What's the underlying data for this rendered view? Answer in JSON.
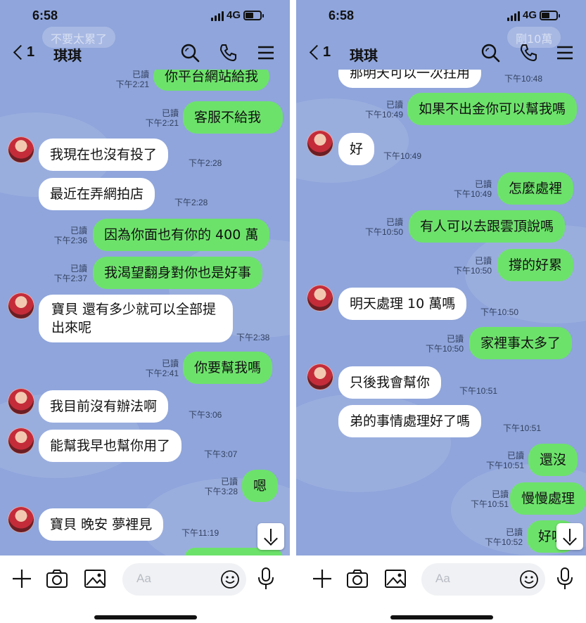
{
  "status": {
    "time": "6:58",
    "network": "4G"
  },
  "header": {
    "unread": "1",
    "contact": "琪琪"
  },
  "left": {
    "ghost_text": "不要太累了",
    "messages": [
      {
        "dir": "out",
        "text": "你平台網站給我",
        "read": "已讀",
        "time": "下午2:21"
      },
      {
        "dir": "out",
        "text": "客服不給我",
        "read": "已讀",
        "time": "下午2:21"
      },
      {
        "dir": "in",
        "text": "我現在也沒有投了",
        "time": "下午2:28",
        "avatar": true
      },
      {
        "dir": "in",
        "text": "最近在弄網拍店",
        "time": "下午2:28"
      },
      {
        "dir": "out",
        "text": "因為你面也有你的 400 萬",
        "read": "已讀",
        "time": "下午2:36"
      },
      {
        "dir": "out",
        "text": "我渴望翻身對你也是好事",
        "read": "已讀",
        "time": "下午2:37"
      },
      {
        "dir": "in",
        "text": "寶貝 還有多少就可以全部提出來呢",
        "time": "下午2:38",
        "avatar": true
      },
      {
        "dir": "out",
        "text": "你要幫我嗎",
        "read": "已讀",
        "time": "下午2:41"
      },
      {
        "dir": "in",
        "text": "我目前沒有辦法啊",
        "time": "下午3:06",
        "avatar": true
      },
      {
        "dir": "in",
        "text": "能幫我早也幫你用了",
        "time": "下午3:07",
        "avatar": true
      },
      {
        "dir": "out",
        "text": "嗯",
        "read": "已讀",
        "time": "下午3:28"
      },
      {
        "dir": "in",
        "text": "寶貝 晚安 夢裡見",
        "time": "下午11:19",
        "avatar": true
      }
    ]
  },
  "right": {
    "ghost_text": "剛10萬",
    "messages": [
      {
        "dir": "in",
        "text": "那明天可以一次拄用",
        "time": "下午10:48"
      },
      {
        "dir": "out",
        "text": "如果不出金你可以幫我嗎",
        "read": "已讀",
        "time": "下午10:49"
      },
      {
        "dir": "in",
        "text": "好",
        "time": "下午10:49",
        "avatar": true
      },
      {
        "dir": "out",
        "text": "怎麼處裡",
        "read": "已讀",
        "time": "下午10:49"
      },
      {
        "dir": "out",
        "text": "有人可以去跟雲頂說嗎",
        "read": "已讀",
        "time": "下午10:50"
      },
      {
        "dir": "out",
        "text": "撐的好累",
        "read": "已讀",
        "time": "下午10:50"
      },
      {
        "dir": "in",
        "text": "明天處理 10 萬嗎",
        "time": "下午10:50",
        "avatar": true
      },
      {
        "dir": "out",
        "text": "家裡事太多了",
        "read": "已讀",
        "time": "下午10:50"
      },
      {
        "dir": "in",
        "text": "只後我會幫你",
        "time": "下午10:51",
        "avatar": true
      },
      {
        "dir": "in",
        "text": "弟的事情處理好了嗎",
        "time": "下午10:51"
      },
      {
        "dir": "out",
        "text": "還沒",
        "read": "已讀",
        "time": "下午10:51"
      },
      {
        "dir": "out",
        "text": "慢慢處理",
        "read": "已讀",
        "time": "下午10:51"
      },
      {
        "dir": "out",
        "text": "好喔",
        "read": "已讀",
        "time": "下午10:52"
      }
    ]
  },
  "input": {
    "placeholder": "Aa"
  },
  "icons": {
    "back": "back-chevron-icon",
    "search": "search-icon",
    "call": "phone-call-icon",
    "menu": "hamburger-menu-icon",
    "plus": "plus-icon",
    "camera": "camera-icon",
    "image": "image-icon",
    "emoji": "emoji-icon",
    "mic": "microphone-icon",
    "scroll": "scroll-down-arrow-icon"
  },
  "colors": {
    "chat_bg": "#8fa5db",
    "outgoing": "#6de26b",
    "incoming": "#ffffff"
  }
}
